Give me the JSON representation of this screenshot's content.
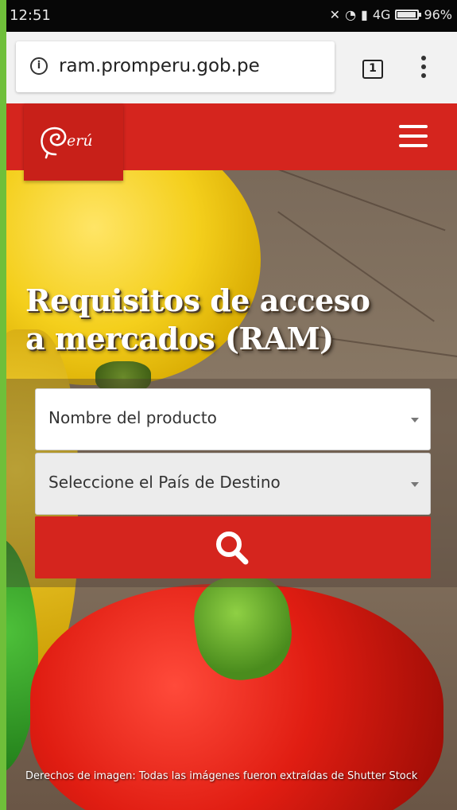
{
  "status_bar": {
    "time": "12:51",
    "network": "4G",
    "battery_percent_label": "96%",
    "battery_level": 0.96
  },
  "browser": {
    "url": "ram.promperu.gob.pe",
    "tab_count": "1"
  },
  "header": {
    "logo_text": "Perú",
    "brand_color": "#d5251e"
  },
  "hero": {
    "title_line1": "Requisitos de acceso",
    "title_line2": "a mercados (RAM)",
    "credit": "Derechos de imagen: Todas las imágenes fueron extraídas de Shutter Stock"
  },
  "search_form": {
    "product_placeholder": "Nombre del producto",
    "country_placeholder": "Seleccione el País de Destino",
    "search_icon": "search-icon"
  }
}
